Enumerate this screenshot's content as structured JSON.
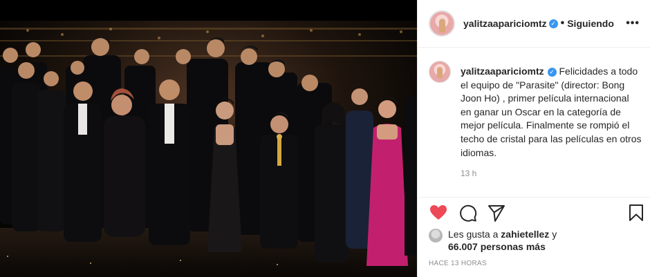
{
  "post": {
    "username": "yalitzaapariciomtz",
    "separator": "•",
    "follow_label": "Siguiendo",
    "more_label": "•••",
    "verified_mark": "✓",
    "caption": "Felicidades a todo el equipo de \"Parasite\" (director: Bong Joon Ho) , primer película internacional en ganar un Oscar en la categoría de mejor película. Finalmente se rompió el techo de cristal para las películas en otros idiomas.",
    "time": "13 h",
    "likes_prefix": "Les gusta a ",
    "likes_user": "zahietellez",
    "likes_and": " y",
    "likes_count": "66.007 personas más",
    "ago": "HACE 13 HORAS"
  },
  "icons": {
    "like": "heart-icon",
    "comment": "comment-icon",
    "share": "share-icon",
    "save": "bookmark-icon"
  },
  "colors": {
    "like_red": "#ed4956",
    "verified_blue": "#3897f0",
    "muted": "#8e8e8e",
    "text": "#262626",
    "border": "#efefef"
  }
}
